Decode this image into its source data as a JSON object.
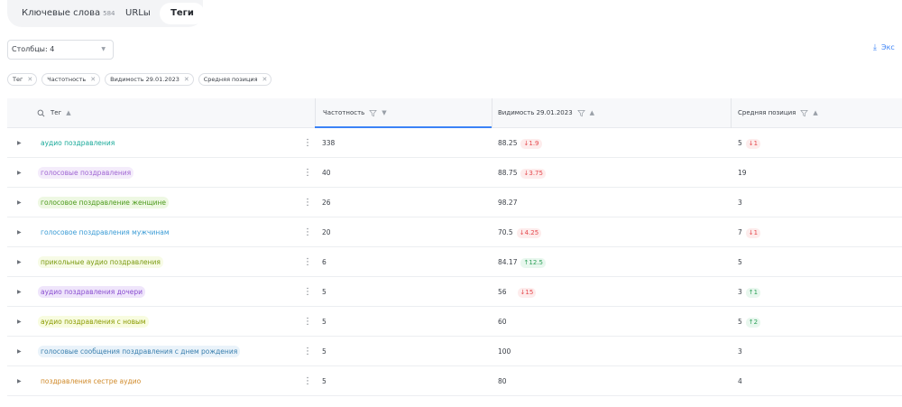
{
  "tabs": {
    "keywords_label": "Ключевые слова",
    "keywords_count": "584",
    "urls_label": "URLы",
    "tags_label": "Теги"
  },
  "controls": {
    "columns_label": "Столбцы: 4",
    "export_label": "Экс"
  },
  "chips": [
    {
      "label": "Тег"
    },
    {
      "label": "Частотность"
    },
    {
      "label": "Видимость 29.01.2023"
    },
    {
      "label": "Средняя позиция"
    }
  ],
  "table": {
    "headers": {
      "tag": "Тег",
      "freq": "Частотность",
      "visibility": "Видимость 29.01.2023",
      "position": "Средняя позиция"
    },
    "rows": [
      {
        "tag": "аудио поздравления",
        "tag_color": "#18a999",
        "tag_bg": "#ffffff",
        "freq": "338",
        "vis": "88.25",
        "vis_delta": "1.9",
        "vis_dir": "down",
        "pos": "5",
        "pos_delta": "1",
        "pos_dir": "down"
      },
      {
        "tag": "голосовые поздравления",
        "tag_color": "#a066d3",
        "tag_bg": "#f4ecfb",
        "freq": "40",
        "vis": "88.75",
        "vis_delta": "3.75",
        "vis_dir": "down",
        "pos": "19",
        "pos_delta": "",
        "pos_dir": ""
      },
      {
        "tag": "голосовое поздравление женщине",
        "tag_color": "#4c9a1c",
        "tag_bg": "#eef8e3",
        "freq": "26",
        "vis": "98.27",
        "vis_delta": "",
        "vis_dir": "",
        "pos": "3",
        "pos_delta": "",
        "pos_dir": ""
      },
      {
        "tag": "голосовое поздравления мужчинам",
        "tag_color": "#3a9bd5",
        "tag_bg": "#ffffff",
        "freq": "20",
        "vis": "70.5",
        "vis_delta": "4.25",
        "vis_dir": "down",
        "pos": "7",
        "pos_delta": "1",
        "pos_dir": "down"
      },
      {
        "tag": "прикольные аудио поздравления",
        "tag_color": "#7a9a10",
        "tag_bg": "#f7fbe6",
        "freq": "6",
        "vis": "84.17",
        "vis_delta": "12.5",
        "vis_dir": "up",
        "pos": "5",
        "pos_delta": "",
        "pos_dir": ""
      },
      {
        "tag": "аудио поздравления дочери",
        "tag_color": "#8a4fd0",
        "tag_bg": "#efe5fb",
        "freq": "5",
        "vis": "56",
        "vis_delta": "15",
        "vis_dir": "down",
        "pos": "3",
        "pos_delta": "1",
        "pos_dir": "up"
      },
      {
        "tag": "аудио поздравления с новым",
        "tag_color": "#8a9a00",
        "tag_bg": "#f8fce0",
        "freq": "5",
        "vis": "60",
        "vis_delta": "",
        "vis_dir": "",
        "pos": "5",
        "pos_delta": "2",
        "pos_dir": "up"
      },
      {
        "tag": "голосовые сообщения поздравления с днем рождения",
        "tag_color": "#3a7fae",
        "tag_bg": "#eaf3fa",
        "freq": "5",
        "vis": "100",
        "vis_delta": "",
        "vis_dir": "",
        "pos": "3",
        "pos_delta": "",
        "pos_dir": ""
      },
      {
        "tag": "поздравления сестре аудио",
        "tag_color": "#d08a2a",
        "tag_bg": "#ffffff",
        "freq": "5",
        "vis": "80",
        "vis_delta": "",
        "vis_dir": "",
        "pos": "4",
        "pos_delta": "",
        "pos_dir": ""
      }
    ]
  },
  "icons": {
    "expand": "triangle-right-icon",
    "menu": "vertical-dots-icon",
    "search": "magnifier-icon",
    "filter": "funnel-icon",
    "sort_up": "sort-up-icon",
    "sort_down": "sort-down-icon",
    "close": "close-icon",
    "download": "download-icon"
  },
  "colors": {
    "accent": "#3b82f6",
    "down": "#e5484d",
    "up": "#2fa15a"
  }
}
